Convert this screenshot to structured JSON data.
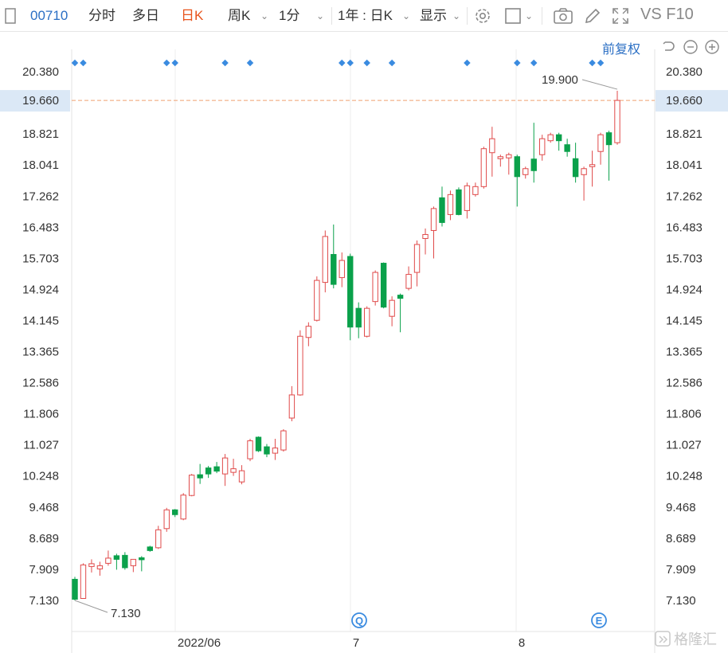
{
  "toolbar": {
    "code": "00710",
    "tabs": [
      "分时",
      "多日",
      "日K",
      "周K",
      "1分",
      "1年 : 日K",
      "显示"
    ],
    "active_tab": "日K",
    "right_text": "VS F10",
    "adjust_label": "前复权"
  },
  "icons": [
    "checkbox-icon",
    "gear-icon",
    "square-icon",
    "camera-icon",
    "pencil-icon",
    "fullscreen-icon",
    "undo-icon",
    "zoom-out-icon",
    "zoom-in-icon"
  ],
  "colors": {
    "up": "#e04a4a",
    "down": "#0aa14b",
    "accent": "#2b6fc4",
    "current": "#e8541c",
    "highlight_bg": "#dbe8f6",
    "marker": "#3a8be0"
  },
  "chart_data": {
    "type": "candlestick",
    "title": "",
    "yticks": [
      "20.380",
      "19.660",
      "18.821",
      "18.041",
      "17.262",
      "16.483",
      "15.703",
      "14.924",
      "14.145",
      "13.365",
      "12.586",
      "11.806",
      "11.027",
      "10.248",
      "9.468",
      "8.689",
      "7.909",
      "7.130"
    ],
    "ylim": [
      7.13,
      20.38
    ],
    "xticks": [
      "2022/06",
      "7",
      "8"
    ],
    "current_price": "19.660",
    "annotations": {
      "high": "19.900",
      "low": "7.130"
    },
    "event_markers": [
      "Q",
      "E"
    ],
    "candles": [
      {
        "o": 7.66,
        "h": 7.72,
        "l": 7.13,
        "c": 7.16
      },
      {
        "o": 7.18,
        "h": 8.06,
        "l": 7.17,
        "c": 8.02
      },
      {
        "o": 7.98,
        "h": 8.16,
        "l": 7.83,
        "c": 8.05
      },
      {
        "o": 7.92,
        "h": 8.1,
        "l": 7.75,
        "c": 8.0
      },
      {
        "o": 8.06,
        "h": 8.38,
        "l": 8.0,
        "c": 8.19
      },
      {
        "o": 8.25,
        "h": 8.3,
        "l": 7.9,
        "c": 8.16
      },
      {
        "o": 8.26,
        "h": 8.34,
        "l": 7.9,
        "c": 7.95
      },
      {
        "o": 8.0,
        "h": 8.1,
        "l": 7.84,
        "c": 8.16
      },
      {
        "o": 8.2,
        "h": 8.24,
        "l": 7.86,
        "c": 8.15
      },
      {
        "o": 8.47,
        "h": 8.5,
        "l": 8.35,
        "c": 8.38
      },
      {
        "o": 8.45,
        "h": 9.0,
        "l": 8.42,
        "c": 8.9
      },
      {
        "o": 8.93,
        "h": 9.45,
        "l": 8.85,
        "c": 9.4
      },
      {
        "o": 9.4,
        "h": 9.42,
        "l": 9.22,
        "c": 9.28
      },
      {
        "o": 9.17,
        "h": 9.82,
        "l": 9.14,
        "c": 9.77
      },
      {
        "o": 9.76,
        "h": 10.3,
        "l": 9.74,
        "c": 10.27
      },
      {
        "o": 10.28,
        "h": 10.55,
        "l": 10.05,
        "c": 10.2
      },
      {
        "o": 10.45,
        "h": 10.5,
        "l": 10.2,
        "c": 10.3
      },
      {
        "o": 10.48,
        "h": 10.6,
        "l": 10.32,
        "c": 10.37
      },
      {
        "o": 10.3,
        "h": 10.8,
        "l": 10.0,
        "c": 10.7
      },
      {
        "o": 10.34,
        "h": 10.68,
        "l": 10.25,
        "c": 10.43
      },
      {
        "o": 10.1,
        "h": 10.52,
        "l": 10.04,
        "c": 10.38
      },
      {
        "o": 10.68,
        "h": 11.18,
        "l": 10.62,
        "c": 11.13
      },
      {
        "o": 11.22,
        "h": 11.24,
        "l": 10.85,
        "c": 10.88
      },
      {
        "o": 10.98,
        "h": 11.05,
        "l": 10.72,
        "c": 10.8
      },
      {
        "o": 10.82,
        "h": 11.18,
        "l": 10.65,
        "c": 10.95
      },
      {
        "o": 10.9,
        "h": 11.42,
        "l": 10.86,
        "c": 11.38
      },
      {
        "o": 11.7,
        "h": 12.5,
        "l": 11.62,
        "c": 12.28
      },
      {
        "o": 12.28,
        "h": 13.9,
        "l": 12.26,
        "c": 13.75
      },
      {
        "o": 13.72,
        "h": 14.1,
        "l": 13.5,
        "c": 14.0
      },
      {
        "o": 14.15,
        "h": 15.25,
        "l": 14.12,
        "c": 15.15
      },
      {
        "o": 15.1,
        "h": 16.4,
        "l": 14.85,
        "c": 16.25
      },
      {
        "o": 15.8,
        "h": 16.55,
        "l": 14.95,
        "c": 15.05
      },
      {
        "o": 15.22,
        "h": 15.85,
        "l": 14.98,
        "c": 15.65
      },
      {
        "o": 15.75,
        "h": 15.82,
        "l": 13.65,
        "c": 13.98
      },
      {
        "o": 14.45,
        "h": 14.6,
        "l": 13.7,
        "c": 13.98
      },
      {
        "o": 13.75,
        "h": 14.5,
        "l": 13.72,
        "c": 14.45
      },
      {
        "o": 14.62,
        "h": 15.4,
        "l": 14.52,
        "c": 15.35
      },
      {
        "o": 15.58,
        "h": 15.6,
        "l": 14.45,
        "c": 14.48
      },
      {
        "o": 14.25,
        "h": 14.75,
        "l": 14.0,
        "c": 14.65
      },
      {
        "o": 14.78,
        "h": 14.82,
        "l": 13.85,
        "c": 14.7
      },
      {
        "o": 14.95,
        "h": 15.5,
        "l": 14.9,
        "c": 15.3
      },
      {
        "o": 15.35,
        "h": 16.15,
        "l": 15.0,
        "c": 16.05
      },
      {
        "o": 16.2,
        "h": 16.45,
        "l": 15.8,
        "c": 16.3
      },
      {
        "o": 16.4,
        "h": 17.0,
        "l": 15.7,
        "c": 16.95
      },
      {
        "o": 17.22,
        "h": 17.5,
        "l": 16.5,
        "c": 16.6
      },
      {
        "o": 16.8,
        "h": 17.4,
        "l": 16.66,
        "c": 17.3
      },
      {
        "o": 17.42,
        "h": 17.48,
        "l": 16.78,
        "c": 16.8
      },
      {
        "o": 16.9,
        "h": 17.6,
        "l": 16.7,
        "c": 17.52
      },
      {
        "o": 17.3,
        "h": 17.6,
        "l": 17.25,
        "c": 17.5
      },
      {
        "o": 17.5,
        "h": 18.5,
        "l": 17.45,
        "c": 18.45
      },
      {
        "o": 18.35,
        "h": 19.0,
        "l": 17.75,
        "c": 18.7
      },
      {
        "o": 18.2,
        "h": 18.3,
        "l": 18.0,
        "c": 18.25
      },
      {
        "o": 18.22,
        "h": 18.35,
        "l": 17.8,
        "c": 18.3
      },
      {
        "o": 18.25,
        "h": 18.3,
        "l": 17.0,
        "c": 17.75
      },
      {
        "o": 17.8,
        "h": 18.0,
        "l": 17.7,
        "c": 17.95
      },
      {
        "o": 18.19,
        "h": 19.1,
        "l": 17.6,
        "c": 17.9
      },
      {
        "o": 18.3,
        "h": 18.8,
        "l": 18.15,
        "c": 18.7
      },
      {
        "o": 18.65,
        "h": 18.85,
        "l": 18.6,
        "c": 18.8
      },
      {
        "o": 18.8,
        "h": 18.85,
        "l": 18.4,
        "c": 18.65
      },
      {
        "o": 18.55,
        "h": 18.7,
        "l": 18.25,
        "c": 18.38
      },
      {
        "o": 18.2,
        "h": 18.6,
        "l": 17.6,
        "c": 17.75
      },
      {
        "o": 17.8,
        "h": 18.0,
        "l": 17.15,
        "c": 17.95
      },
      {
        "o": 18.0,
        "h": 18.4,
        "l": 17.5,
        "c": 18.05
      },
      {
        "o": 18.38,
        "h": 18.85,
        "l": 18.05,
        "c": 18.8
      },
      {
        "o": 18.85,
        "h": 18.9,
        "l": 17.65,
        "c": 18.55
      },
      {
        "o": 18.6,
        "h": 19.9,
        "l": 18.55,
        "c": 19.66
      }
    ]
  }
}
